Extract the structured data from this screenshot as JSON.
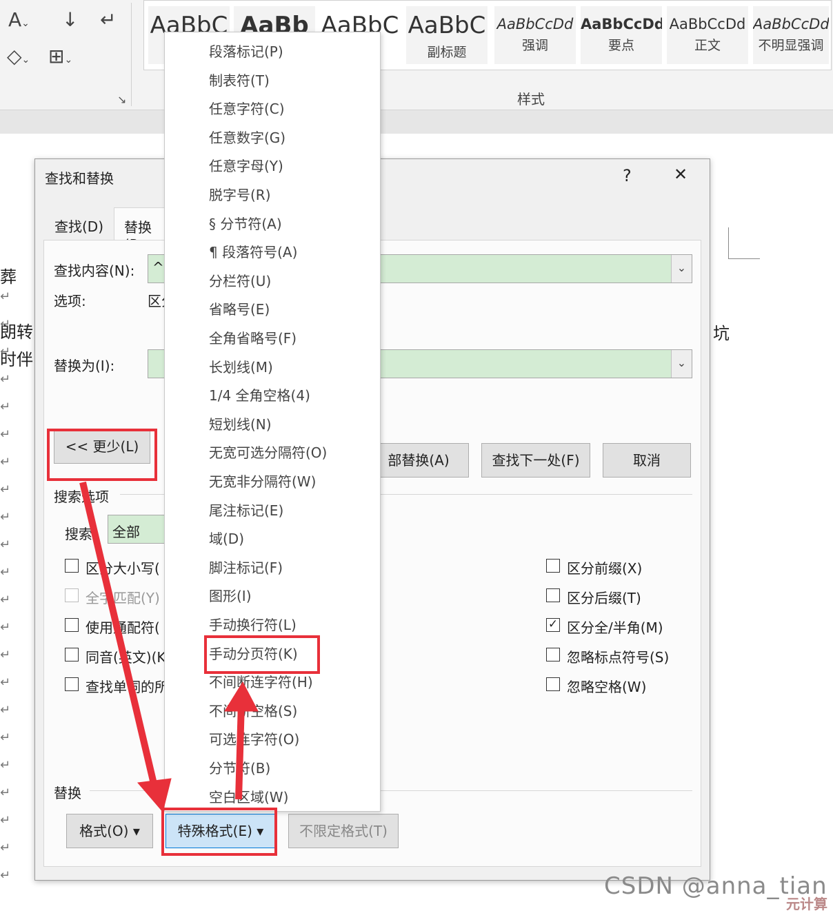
{
  "ribbon": {
    "style_tiles": [
      {
        "sample": "AaBbC",
        "name": "",
        "bold": false
      },
      {
        "sample": "AaBb",
        "name": "",
        "bold": true
      },
      {
        "sample": "AaBbC",
        "name": "",
        "bold": false
      },
      {
        "sample": "AaBbC",
        "name": "副标题",
        "bold": false
      },
      {
        "sample": "AaBbCcDd",
        "name": "强调",
        "bold": false
      },
      {
        "sample": "AaBbCcDd",
        "name": "要点",
        "bold": false
      },
      {
        "sample": "AaBbCcDd",
        "name": "正文",
        "bold": false
      },
      {
        "sample": "AaBbCcDd",
        "name": "不明显强调",
        "bold": false
      }
    ],
    "styles_group_label": "样式"
  },
  "document": {
    "left_fragments": [
      "葬",
      "朗转",
      "时伴"
    ],
    "right_fragment": "坑"
  },
  "dialog": {
    "title": "查找和替换",
    "help": "?",
    "close": "✕",
    "tabs": [
      "查找(D)",
      "替换(P"
    ],
    "find_label": "查找内容(N):",
    "find_value": "^r",
    "options_label": "选项:",
    "options_value": "区分",
    "replace_label": "替换为(I):",
    "replace_value": "",
    "buttons": {
      "less": "<< 更少(L)",
      "replace_all": "部替换(A)",
      "find_next": "查找下一处(F)",
      "cancel": "取消"
    },
    "search_options_title": "搜索选项",
    "search_label": "搜索:",
    "search_value": "全部",
    "left_checks": [
      {
        "label": "区分大小写(",
        "checked": false,
        "disabled": false
      },
      {
        "label": "全字匹配(Y)",
        "checked": false,
        "disabled": true
      },
      {
        "label": "使用通配符(",
        "checked": false,
        "disabled": false
      },
      {
        "label": "同音(英文)(K",
        "checked": false,
        "disabled": false
      },
      {
        "label": "查找单词的所",
        "checked": false,
        "disabled": false
      }
    ],
    "right_checks": [
      {
        "label": "区分前缀(X)",
        "checked": false
      },
      {
        "label": "区分后缀(T)",
        "checked": false
      },
      {
        "label": "区分全/半角(M)",
        "checked": true
      },
      {
        "label": "忽略标点符号(S)",
        "checked": false
      },
      {
        "label": "忽略空格(W)",
        "checked": false
      }
    ],
    "replace_group_title": "替换",
    "format_button": "格式(O) ▾",
    "special_button": "特殊格式(E) ▾",
    "no_format_button": "不限定格式(T)"
  },
  "menu": {
    "items": [
      "段落标记(P)",
      "制表符(T)",
      "任意字符(C)",
      "任意数字(G)",
      "任意字母(Y)",
      "脱字号(R)",
      "§ 分节符(A)",
      "¶ 段落符号(A)",
      "分栏符(U)",
      "省略号(E)",
      "全角省略号(F)",
      "长划线(M)",
      "1/4 全角空格(4)",
      "短划线(N)",
      "无宽可选分隔符(O)",
      "无宽非分隔符(W)",
      "尾注标记(E)",
      "域(D)",
      "脚注标记(F)",
      "图形(I)",
      "手动换行符(L)",
      "手动分页符(K)",
      "不间断连字符(H)",
      "不间断空格(S)",
      "可选连字符(O)",
      "分节符(B)",
      "空白区域(W)"
    ]
  },
  "watermark": {
    "text": "CSDN @anna_tian",
    "corner": "元计算"
  },
  "colors": {
    "highlight": "#e8303a",
    "combo_fill": "#d4ecd4"
  }
}
